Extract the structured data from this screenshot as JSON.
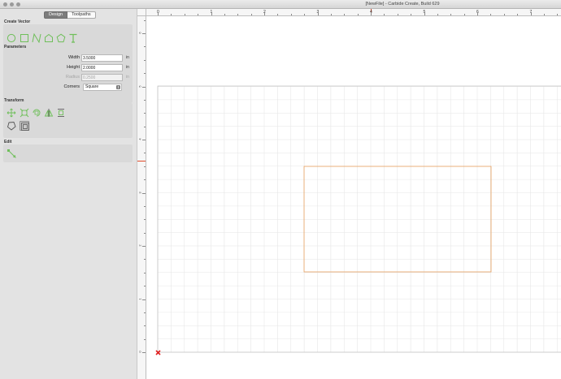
{
  "window": {
    "title": "[NewFile] - Carbide Create, Build 629"
  },
  "tabs": {
    "design": "Design",
    "toolpaths": "Toolpaths"
  },
  "create_vector": {
    "label": "Create Vector",
    "tools": [
      "circle-tool",
      "rectangle-tool",
      "curve-tool",
      "polyline-tool",
      "polygon-tool",
      "text-tool"
    ]
  },
  "parameters": {
    "label": "Parameters",
    "width_label": "Width",
    "width_value": "3.5000",
    "width_unit": "in",
    "height_label": "Height",
    "height_value": "2.0000",
    "height_unit": "in",
    "radius_label": "Radius",
    "radius_value": "0.2500",
    "radius_unit": "in",
    "corners_label": "Corners",
    "corners_value": "Square"
  },
  "transform": {
    "label": "Transform",
    "tools": [
      "move-tool",
      "scale-tool",
      "rotate-tool",
      "mirror-tool",
      "align-tool",
      "rotate-free-tool",
      "offset-tool"
    ]
  },
  "edit": {
    "label": "Edit",
    "tools": [
      "node-edit-tool"
    ]
  },
  "ruler": {
    "top_labels": [
      "0",
      "1",
      "2",
      "3",
      "4",
      "5",
      "6",
      "7"
    ],
    "left_labels": [
      "6",
      "5",
      "4",
      "3",
      "2",
      "1",
      "0"
    ]
  },
  "colors": {
    "shape_stroke": "#e8a15e",
    "grid_line": "#e6e6e6",
    "icon_green": "#6fbf5a",
    "cursor_marker": "#e04a2a",
    "origin_marker": "#e02020"
  }
}
